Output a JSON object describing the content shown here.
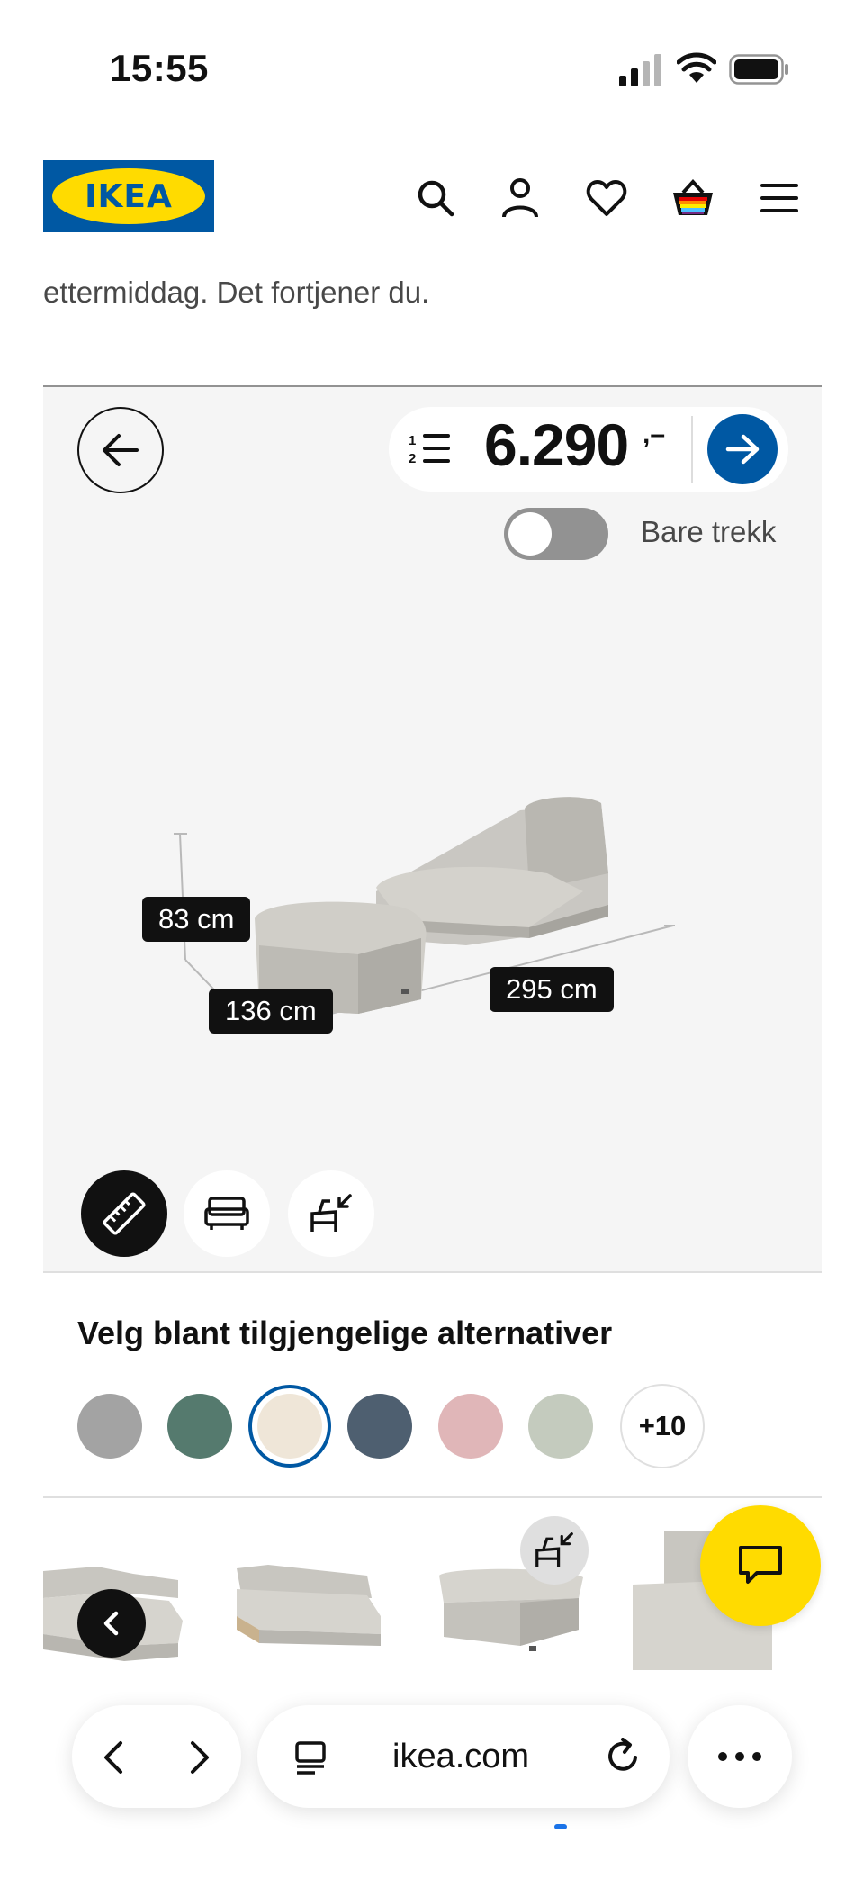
{
  "status_bar": {
    "time": "15:55"
  },
  "header": {
    "logo_text": "IKEA"
  },
  "intro": {
    "text": "ettermiddag. Det fortjener du."
  },
  "configurator": {
    "price_main": "6.290",
    "price_suffix": ",–",
    "toggle_label": "Bare trekk",
    "toggle_on": false,
    "dimensions": {
      "height": "83 cm",
      "depth": "136 cm",
      "width": "295 cm"
    }
  },
  "options": {
    "title": "Velg blant tilgjengelige alternativer",
    "swatches": [
      "#a3a3a3",
      "#557a6e",
      "#efe6d8",
      "#4e5f70",
      "#e0b6b8",
      "#c4cbbe"
    ],
    "selected_swatch": 2,
    "more_label": "+10"
  },
  "browser": {
    "url": "ikea.com"
  },
  "colors": {
    "ikea_blue": "#0058a3",
    "ikea_yellow": "#ffdb00"
  }
}
